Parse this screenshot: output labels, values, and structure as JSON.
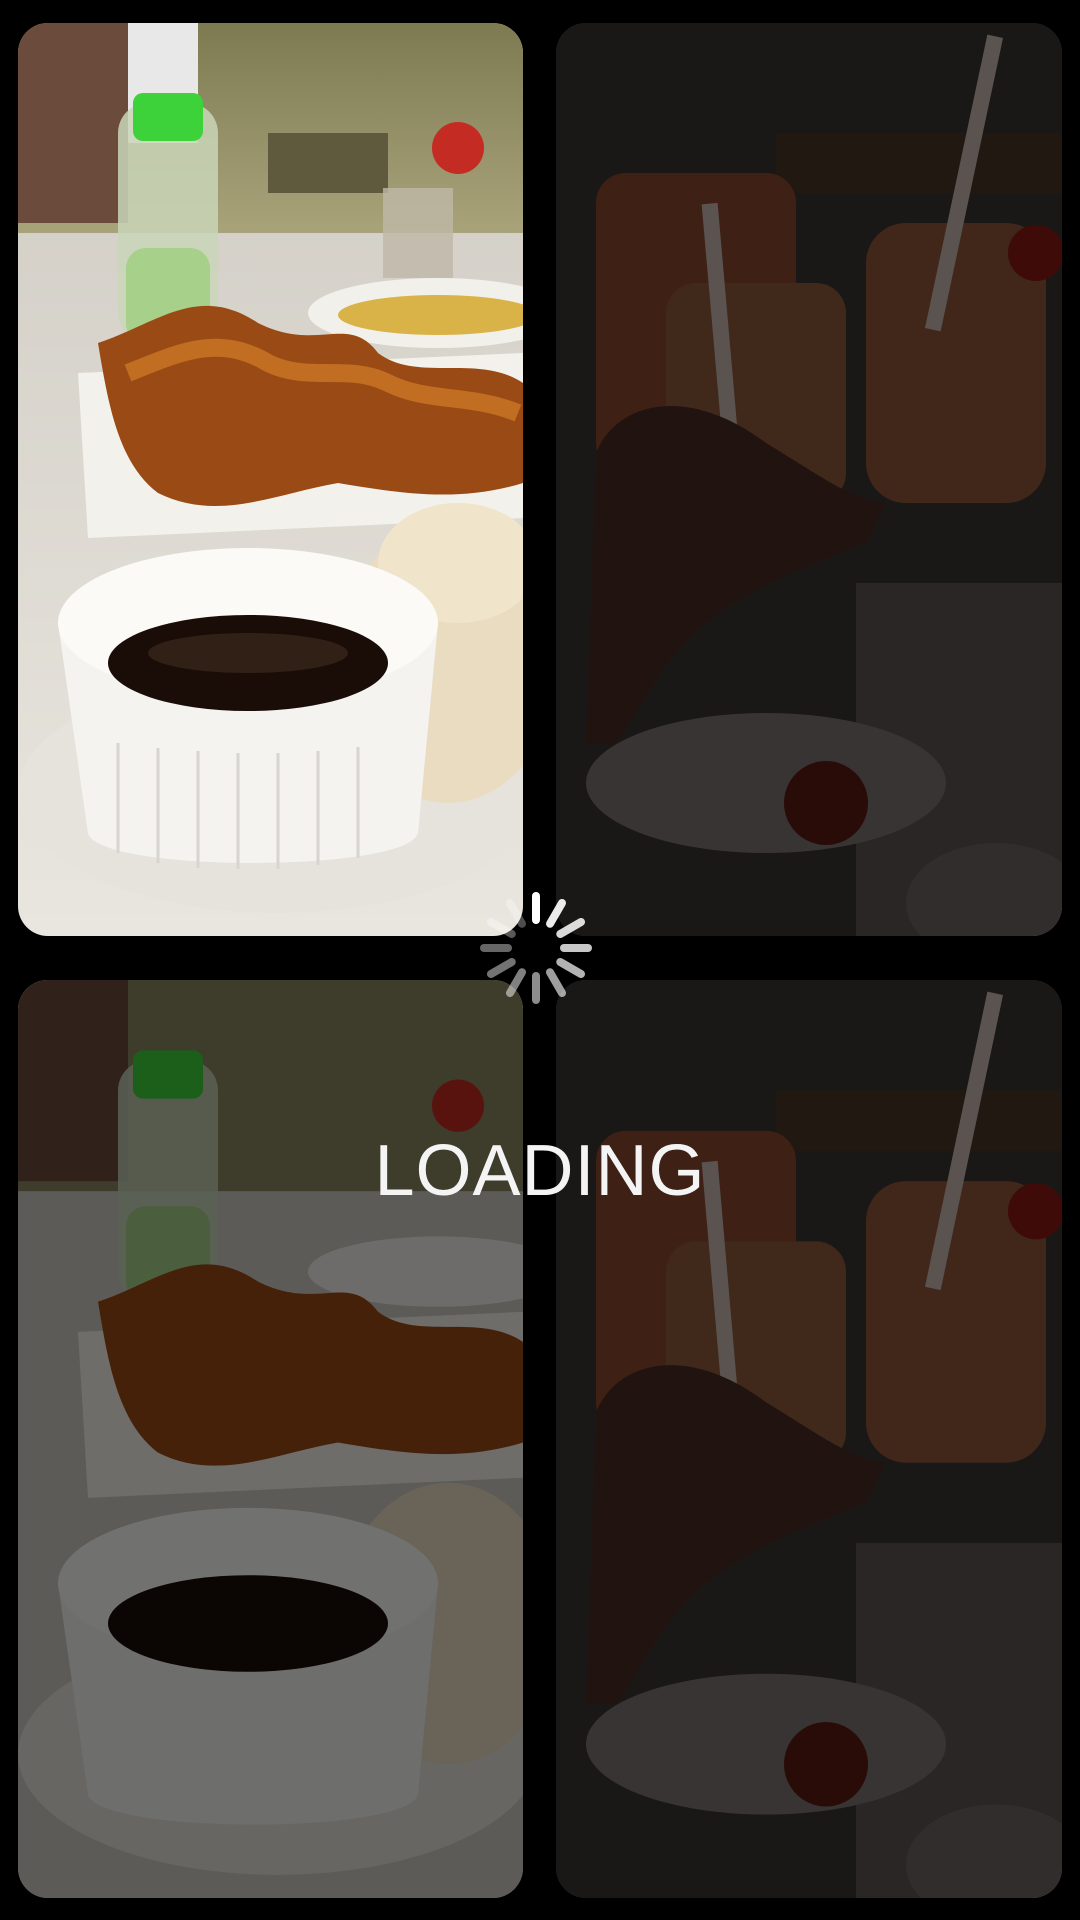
{
  "loading": {
    "label": "LOADING"
  },
  "tiles": [
    {
      "id": "top-left",
      "subject": "fried-wings-and-dumplings-photo",
      "dimmed": false
    },
    {
      "id": "top-right",
      "subject": "cocktails-toast-photo",
      "dimmed": true
    },
    {
      "id": "bottom-left",
      "subject": "fried-wings-and-dumplings-photo",
      "dimmed": true
    },
    {
      "id": "bottom-right",
      "subject": "cocktails-toast-photo",
      "dimmed": true
    }
  ],
  "colors": {
    "background": "#000000",
    "text": "#f4f4f4",
    "overlay": "rgba(0,0,0,0.55)"
  },
  "icons": {
    "spinner": "loading-spinner-icon"
  }
}
